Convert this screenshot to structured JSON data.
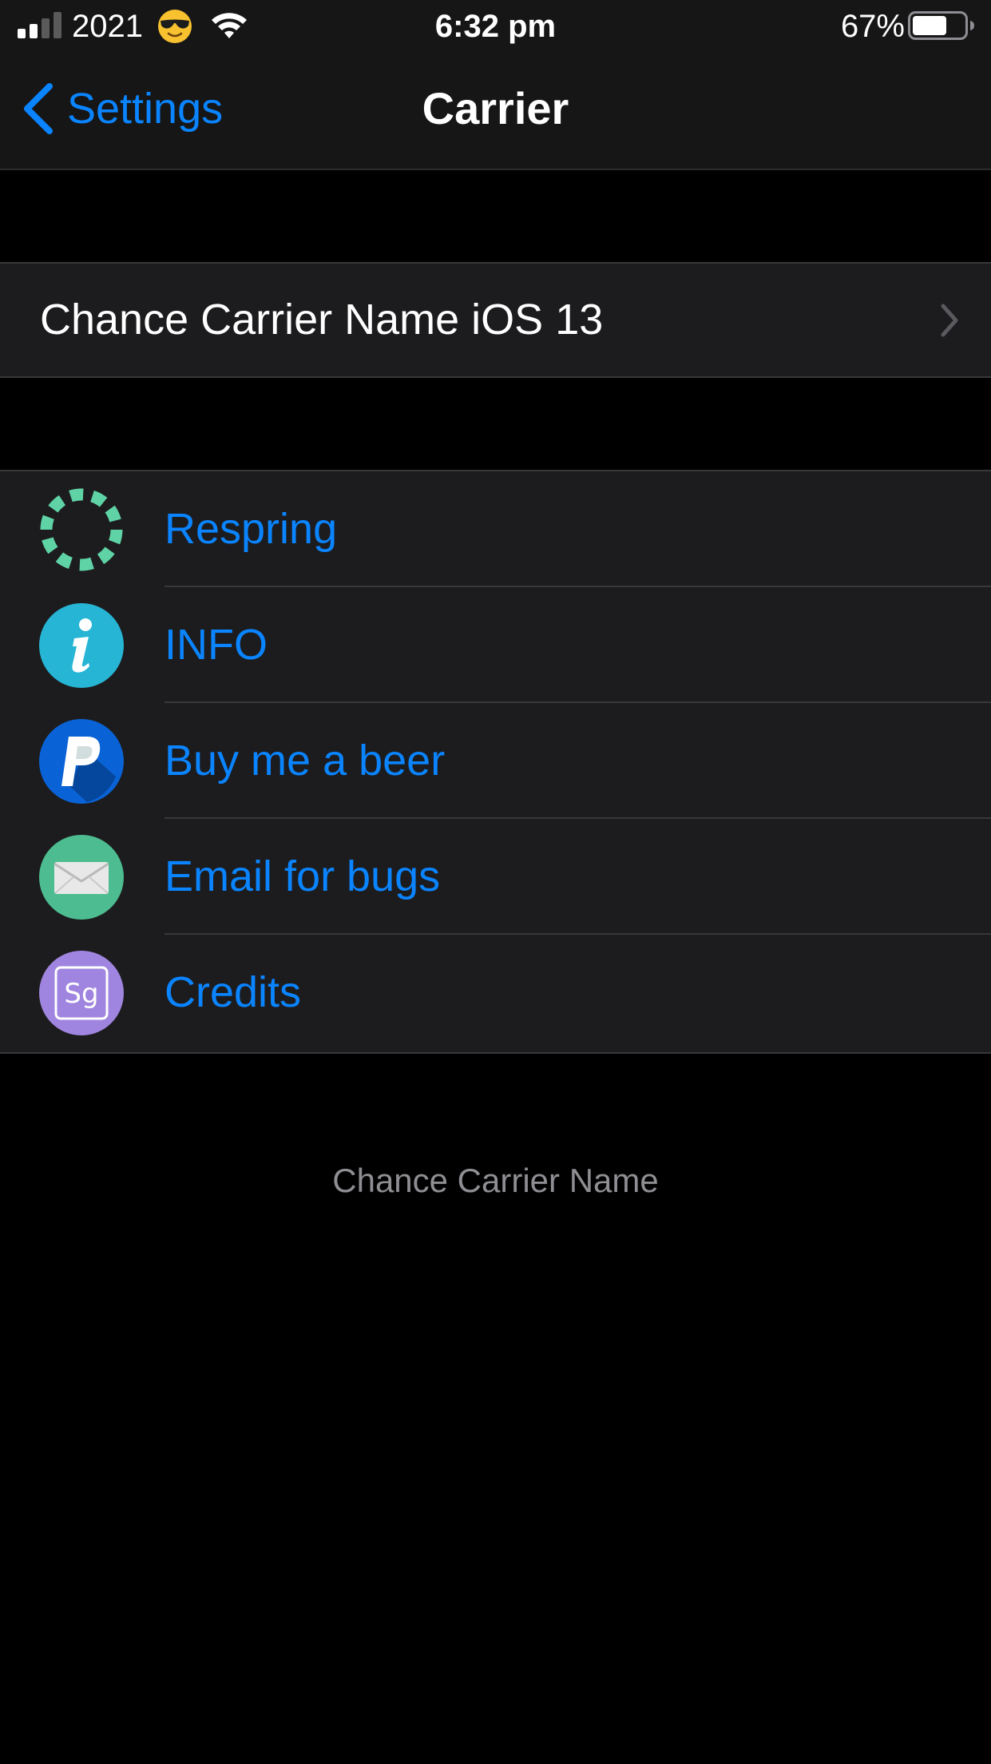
{
  "status_bar": {
    "carrier": "2021",
    "emoji": "smiling-face-with-sunglasses",
    "time": "6:32 pm",
    "battery_percent": "67%",
    "battery_level": 0.67,
    "signal_bars_active": 2,
    "signal_bars_total": 4
  },
  "nav": {
    "back_label": "Settings",
    "title": "Carrier"
  },
  "group_1": {
    "item_label": "Chance Carrier Name iOS 13"
  },
  "group_2": {
    "items": [
      {
        "label": "Respring",
        "icon": "respring-icon"
      },
      {
        "label": "INFO",
        "icon": "info-icon"
      },
      {
        "label": "Buy me a beer",
        "icon": "paypal-icon"
      },
      {
        "label": "Email for bugs",
        "icon": "mail-icon"
      },
      {
        "label": "Credits",
        "icon": "credits-icon"
      }
    ]
  },
  "footer": {
    "text": "Chance Carrier Name"
  },
  "colors": {
    "accent": "#0a84ff",
    "background": "#000000",
    "cell": "#1c1c1e",
    "secondary_text": "#8e8e93"
  }
}
